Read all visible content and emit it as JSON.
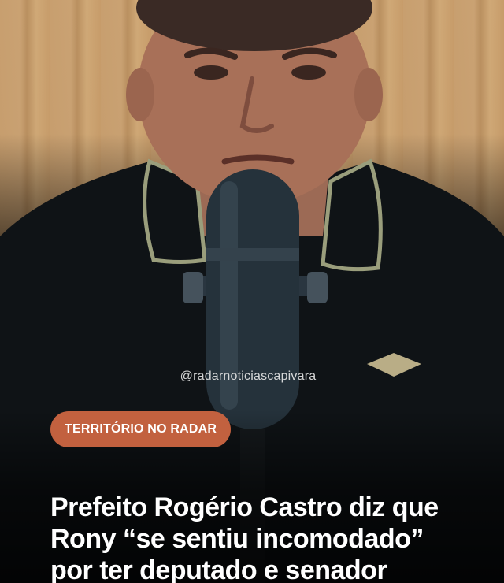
{
  "post": {
    "handle": "@radarnoticiascapivara",
    "category_tag": "TERRITÓRIO NO RADAR",
    "headline_lines": [
      "Prefeito Rogério Castro diz que",
      "Rony “se sentiu incomodado”",
      "por ter deputado e senador"
    ],
    "colors": {
      "tag_background": "#c2613f",
      "text": "#ffffff"
    }
  }
}
